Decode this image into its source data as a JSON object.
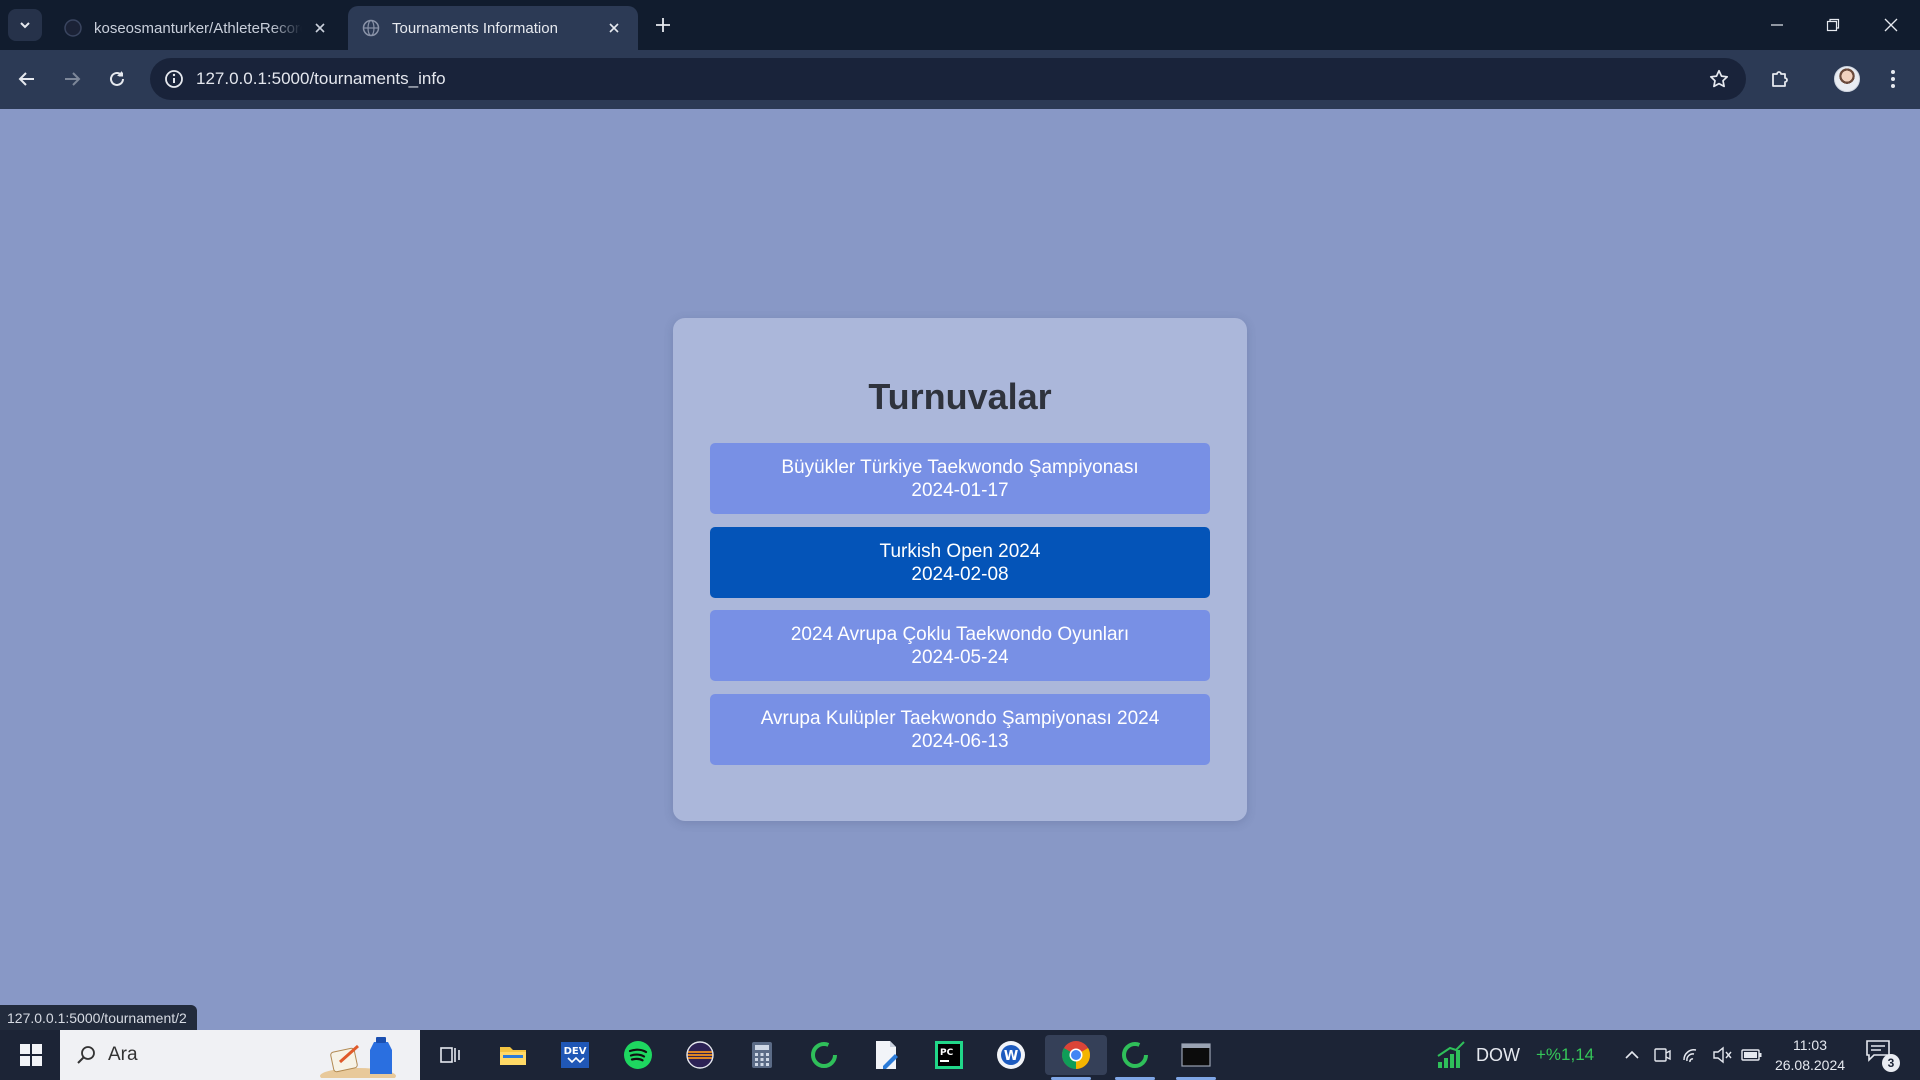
{
  "browser": {
    "tabs": [
      {
        "title": "koseosmanturker/AthleteRecords",
        "active": false
      },
      {
        "title": "Tournaments Information",
        "active": true
      }
    ],
    "url": "127.0.0.1:5000/tournaments_info",
    "status_url": "127.0.0.1:5000/tournament/2"
  },
  "page": {
    "heading": "Turnuvalar",
    "tournaments": [
      {
        "name": "Büyükler Türkiye Taekwondo Şampiyonası",
        "date": "2024-01-17",
        "hovered": false
      },
      {
        "name": "Turkish Open 2024",
        "date": "2024-02-08",
        "hovered": true
      },
      {
        "name": "2024 Avrupa Çoklu Taekwondo Oyunları",
        "date": "2024-05-24",
        "hovered": false
      },
      {
        "name": "Avrupa Kulüpler Taekwondo Şampiyonası 2024",
        "date": "2024-06-13",
        "hovered": false
      }
    ],
    "colors": {
      "background": "#8898c6",
      "card": "#abb7da",
      "item": "#7890e5",
      "item_hover": "#0454b8"
    }
  },
  "taskbar": {
    "search_placeholder": "Ara",
    "apps": [
      "task-view",
      "file-explorer",
      "dev-app",
      "spotify",
      "eclipse",
      "calculator",
      "loader-app",
      "editor",
      "pycharm",
      "word-app",
      "chrome",
      "loader-app-2",
      "terminal"
    ],
    "ticker": {
      "symbol": "DOW",
      "change": "+%1,14"
    },
    "time": "11:03",
    "date": "26.08.2024",
    "notifications": "3"
  }
}
